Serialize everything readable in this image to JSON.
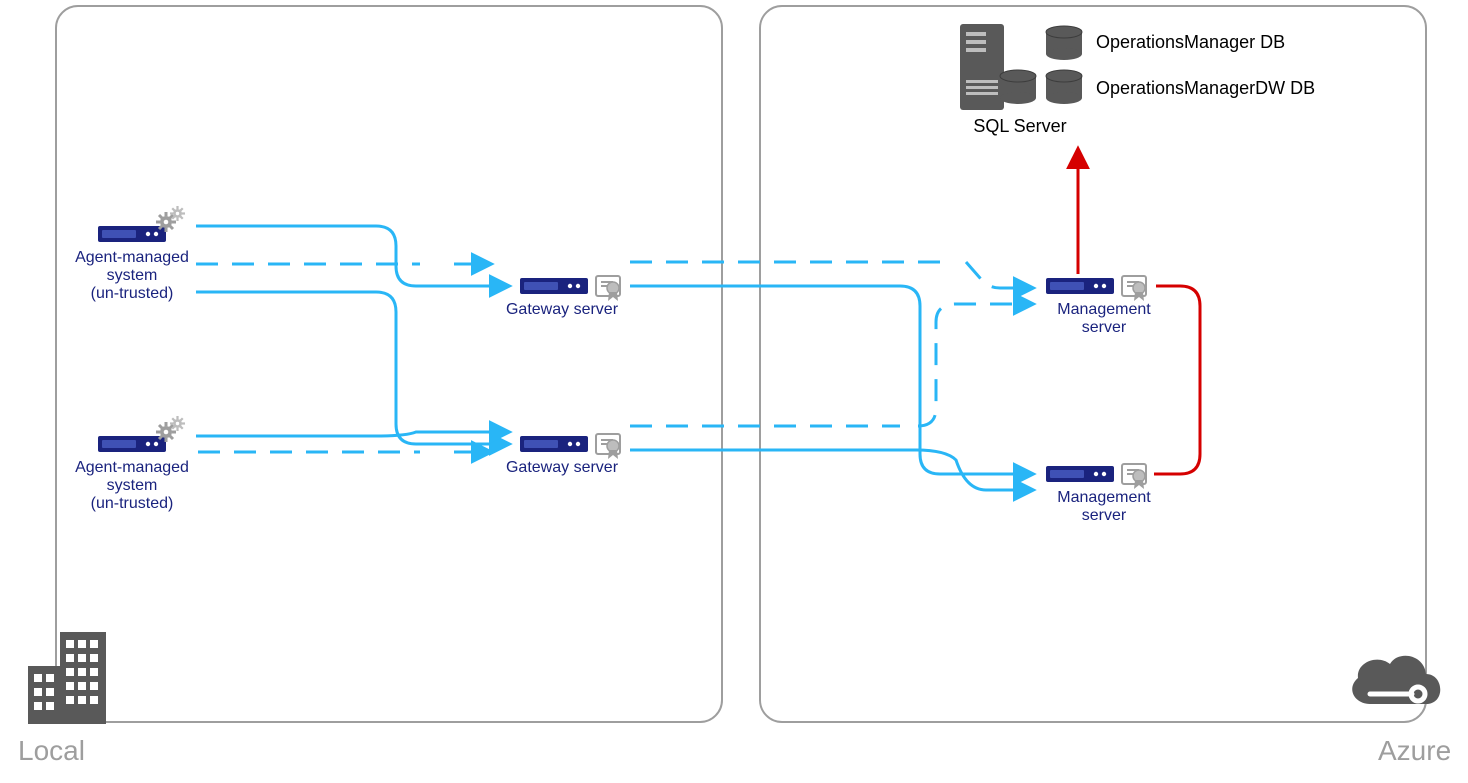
{
  "zones": {
    "local": "Local",
    "azure": "Azure"
  },
  "nodes": {
    "agent1": {
      "label1": "Agent-managed",
      "label2": "system",
      "label3": "(un-trusted)"
    },
    "agent2": {
      "label1": "Agent-managed",
      "label2": "system",
      "label3": "(un-trusted)"
    },
    "gateway1": {
      "label": "Gateway server"
    },
    "gateway2": {
      "label": "Gateway server"
    },
    "mgmt1": {
      "label1": "Management",
      "label2": "server"
    },
    "mgmt2": {
      "label1": "Management",
      "label2": "server"
    },
    "sql": {
      "label": "SQL Server"
    },
    "db1": {
      "label": "OperationsManager DB"
    },
    "db2": {
      "label": "OperationsManagerDW DB"
    }
  },
  "colors": {
    "zone_border": "#9e9e9e",
    "flow_blue": "#29b6f6",
    "flow_red": "#d50000",
    "server_blue": "#1a237e",
    "icon_grey": "#757575",
    "db_grey": "#595959"
  }
}
